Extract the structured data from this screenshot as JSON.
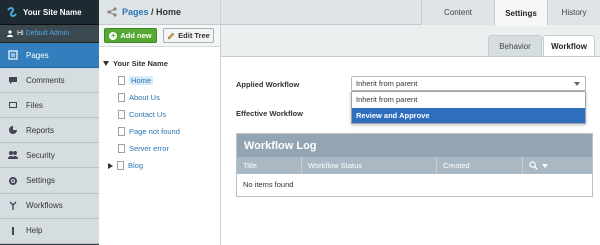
{
  "brand": {
    "name": "Your Site Name"
  },
  "user": {
    "greeting": "Hi",
    "name": "Default Admin"
  },
  "menu": [
    {
      "label": "Pages",
      "icon": "pages-icon",
      "active": true
    },
    {
      "label": "Comments",
      "icon": "comments-icon"
    },
    {
      "label": "Files",
      "icon": "files-icon"
    },
    {
      "label": "Reports",
      "icon": "reports-icon"
    },
    {
      "label": "Security",
      "icon": "security-icon"
    },
    {
      "label": "Settings",
      "icon": "settings-icon"
    },
    {
      "label": "Workflows",
      "icon": "workflows-icon"
    },
    {
      "label": "Help",
      "icon": "help-icon"
    }
  ],
  "breadcrumb": {
    "parent": "Pages",
    "separator": " / ",
    "current": "Home"
  },
  "toolbar": {
    "add_label": "Add new",
    "edit_tree_label": "Edit Tree"
  },
  "tree": {
    "root": "Your Site Name",
    "nodes": [
      "Home",
      "About Us",
      "Contact Us",
      "Page not found",
      "Server error",
      "Blog"
    ]
  },
  "top_tabs": [
    "Content",
    "Settings",
    "History"
  ],
  "sub_tabs": [
    "Behavior",
    "Workflow"
  ],
  "form": {
    "applied_label": "Applied Workflow",
    "applied_value": "Inherit from parent",
    "effective_label": "Effective Workflow",
    "options": [
      "Inherit from parent",
      "Review and Approve"
    ]
  },
  "workflow_log": {
    "title": "Workflow Log",
    "columns": [
      "Title",
      "Workflow Status",
      "Created"
    ],
    "empty_text": "No items found"
  },
  "colors": {
    "accent": "#337fbd",
    "add_button": "#55a833",
    "highlight": "#2e6ebc",
    "log_header": "#93a5b2"
  }
}
